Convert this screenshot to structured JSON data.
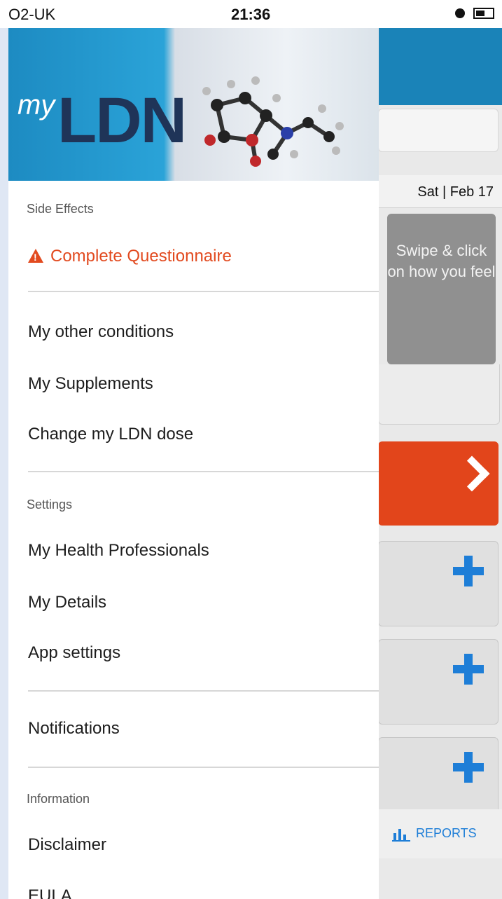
{
  "status_bar": {
    "carrier": "O2-UK",
    "time": "21:36"
  },
  "background_app": {
    "date": "Sat | Feb 17",
    "swipe_text": "Swipe & click on how you feel",
    "reports_label": "REPORTS"
  },
  "drawer": {
    "logo_my": "my",
    "logo_ldn": "LDN",
    "side_effects_label": "Side Effects",
    "complete_questionnaire": "Complete Questionnaire",
    "my_other_conditions": "My other conditions",
    "my_supplements": "My Supplements",
    "change_ldn_dose": "Change my LDN dose",
    "settings_label": "Settings",
    "my_health_professionals": "My Health Professionals",
    "my_details": "My Details",
    "app_settings": "App settings",
    "notifications": "Notifications",
    "information_label": "Information",
    "disclaimer": "Disclaimer",
    "eula": "EULA"
  },
  "colors": {
    "accent_blue": "#1a83b8",
    "alert_red": "#e24a1f",
    "plus_blue": "#1e7ed7"
  }
}
